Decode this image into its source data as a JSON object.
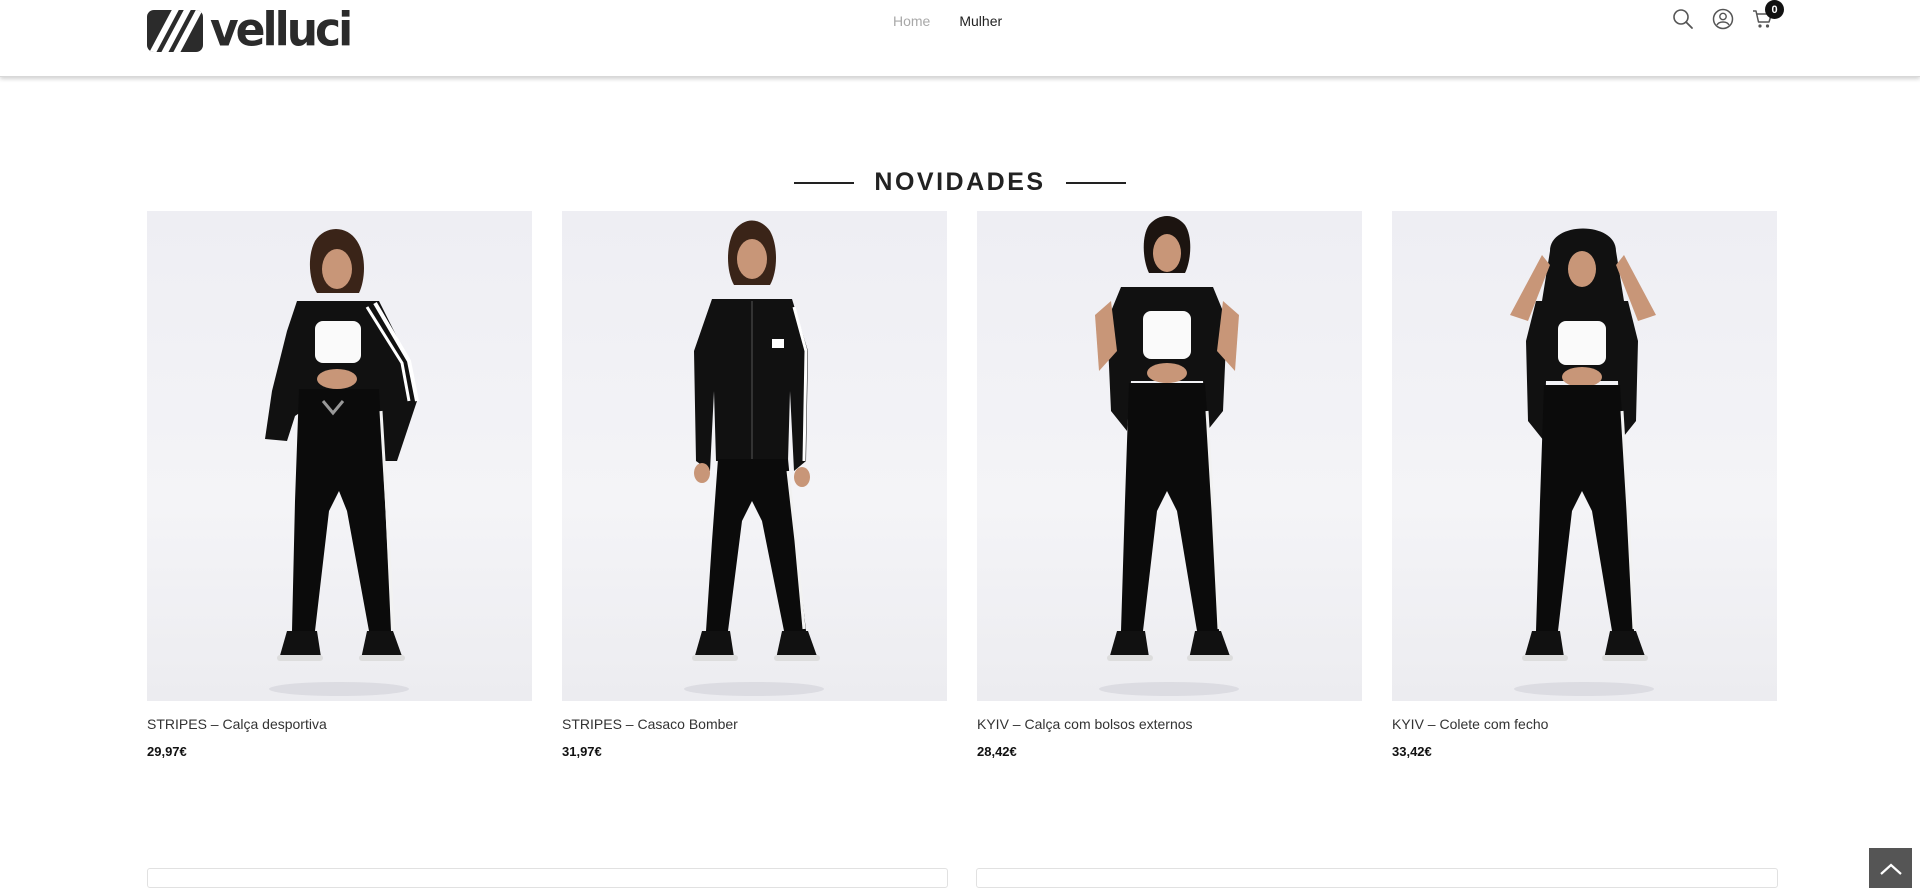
{
  "header": {
    "brand": "velluci",
    "nav": [
      {
        "label": "Home",
        "state": "active"
      },
      {
        "label": "Mulher",
        "state": "default"
      }
    ],
    "icons": [
      "search-icon",
      "user-icon",
      "cart-icon"
    ],
    "cart_count": "0"
  },
  "section": {
    "title": "NOVIDADES"
  },
  "products": [
    {
      "name": "STRIPES – Calça desportiva",
      "price": "29,97€"
    },
    {
      "name": "STRIPES – Casaco Bomber",
      "price": "31,97€"
    },
    {
      "name": "KYIV – Calça com bolsos externos",
      "price": "28,42€"
    },
    {
      "name": "KYIV – Colete com fecho",
      "price": "33,42€"
    }
  ],
  "colors": {
    "text_dark": "#222222",
    "nav_inactive": "#a8a8a8",
    "accent_dark": "#111111",
    "back_to_top": "#555555"
  }
}
